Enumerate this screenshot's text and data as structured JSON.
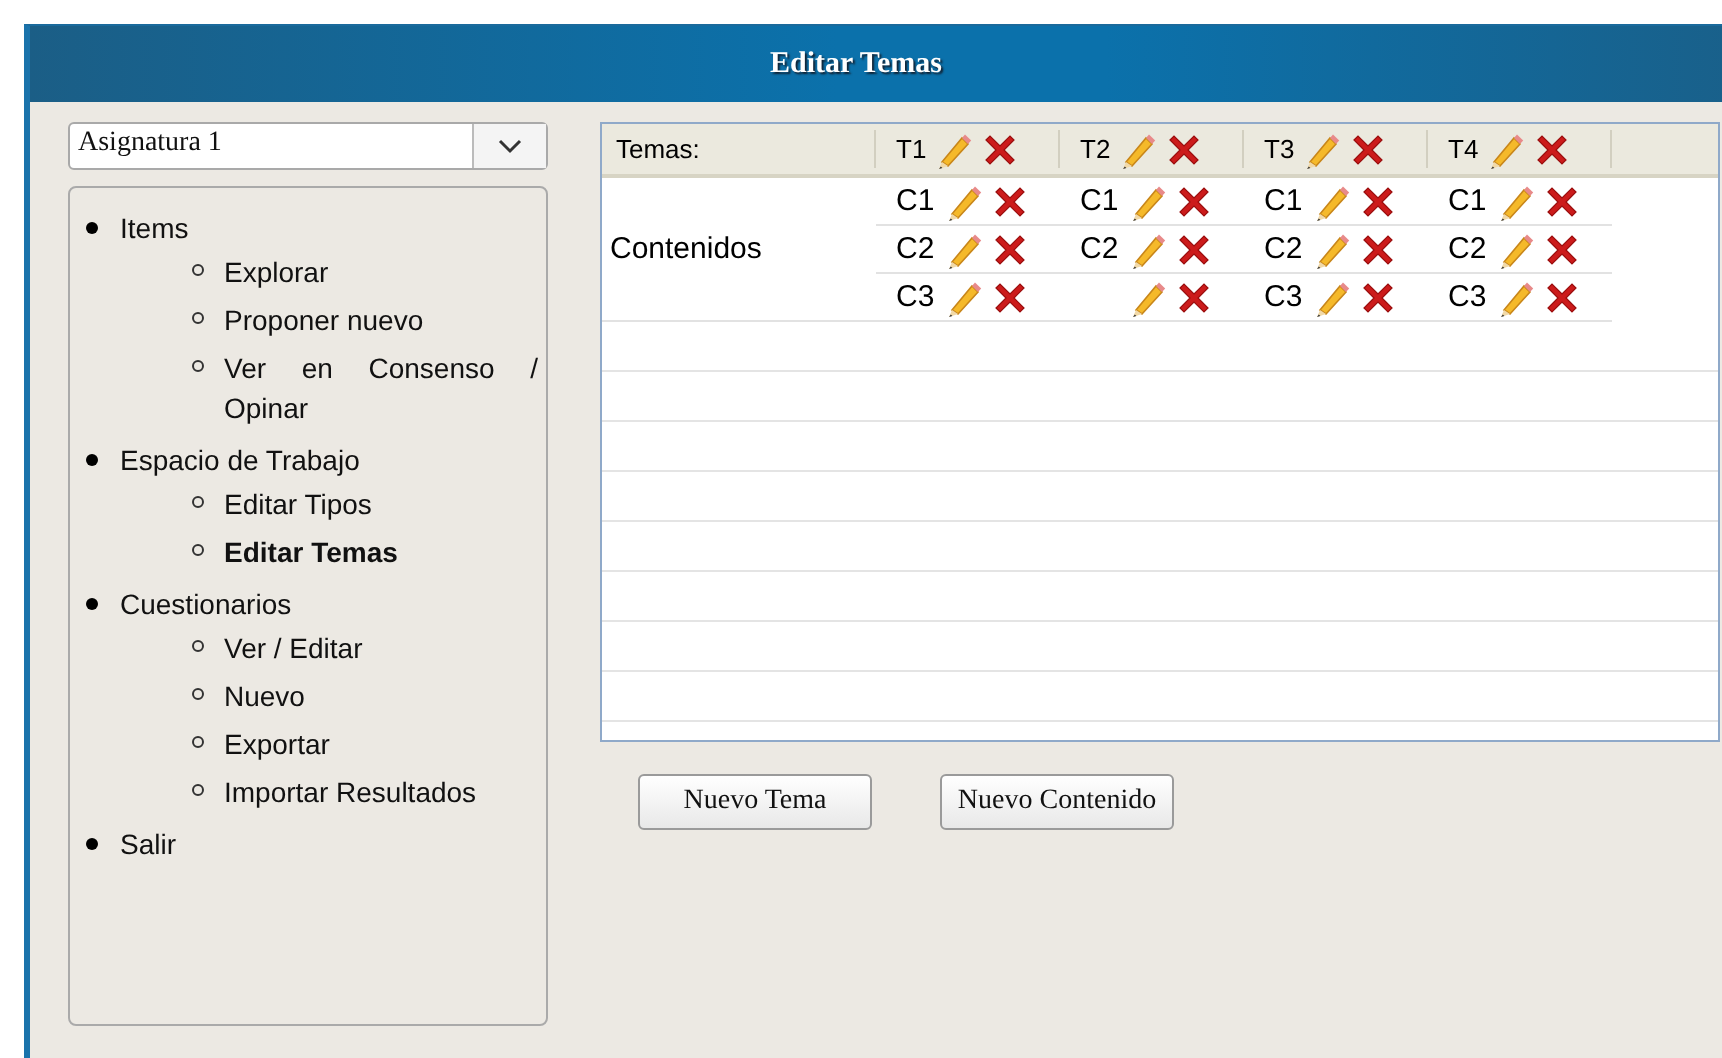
{
  "window": {
    "title": "Editar Temas"
  },
  "subject_select": {
    "value": "Asignatura 1"
  },
  "nav": [
    {
      "label": "Items",
      "children": [
        {
          "label": "Explorar",
          "selected": false
        },
        {
          "label": "Proponer nuevo",
          "selected": false
        },
        {
          "label": "Ver en Consenso / Opinar",
          "selected": false
        }
      ]
    },
    {
      "label": "Espacio de Trabajo",
      "children": [
        {
          "label": "Editar Tipos",
          "selected": false
        },
        {
          "label": "Editar Temas",
          "selected": true
        }
      ]
    },
    {
      "label": "Cuestionarios",
      "children": [
        {
          "label": "Ver / Editar",
          "selected": false
        },
        {
          "label": "Nuevo",
          "selected": false
        },
        {
          "label": "Exportar",
          "selected": false
        },
        {
          "label": "Importar Resultados",
          "selected": false
        }
      ]
    },
    {
      "label": "Salir"
    }
  ],
  "grid": {
    "header_label": "Temas:",
    "row_label": "Contenidos",
    "temas": [
      {
        "label": "T1",
        "contents": [
          {
            "kind": "labeled",
            "label": "C1"
          },
          {
            "kind": "labeled",
            "label": "C2"
          },
          {
            "kind": "labeled",
            "label": "C3"
          }
        ]
      },
      {
        "label": "T2",
        "contents": [
          {
            "kind": "labeled",
            "label": "C1"
          },
          {
            "kind": "labeled",
            "label": "C2"
          },
          {
            "kind": "unlabeled"
          }
        ]
      },
      {
        "label": "T3",
        "contents": [
          {
            "kind": "labeled",
            "label": "C1"
          },
          {
            "kind": "labeled",
            "label": "C2"
          },
          {
            "kind": "labeled",
            "label": "C3"
          }
        ]
      },
      {
        "label": "T4",
        "contents": [
          {
            "kind": "labeled",
            "label": "C1"
          },
          {
            "kind": "labeled",
            "label": "C2"
          },
          {
            "kind": "labeled",
            "label": "C3"
          }
        ]
      }
    ]
  },
  "buttons": [
    "Nuevo Tema",
    "Nuevo Contenido"
  ]
}
